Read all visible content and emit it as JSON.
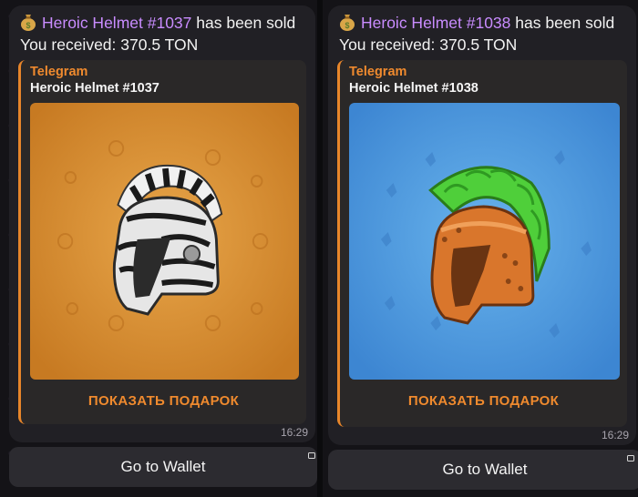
{
  "chats": [
    {
      "emoji_icon": "money-bag-icon",
      "gift_link": "Heroic Helmet #1037",
      "sold_text": " has been sold",
      "received_text": "You received: 370.5 TON",
      "preview": {
        "site_name": "Telegram",
        "title": "Heroic Helmet #1037",
        "image": "zebra-striped-helmet-on-orange",
        "background_color": "#d58a2c",
        "button_label": "ПОКАЗАТЬ ПОДАРОК"
      },
      "time": "16:29",
      "wallet_button": "Go to Wallet"
    },
    {
      "emoji_icon": "money-bag-icon",
      "gift_link": "Heroic Helmet #1038",
      "sold_text": " has been sold",
      "received_text": "You received: 370.5 TON",
      "preview": {
        "site_name": "Telegram",
        "title": "Heroic Helmet #1038",
        "image": "bronze-helmet-green-crest-on-blue",
        "background_color": "#4a92d8",
        "button_label": "ПОКАЗАТЬ ПОДАРОК"
      },
      "time": "16:29",
      "wallet_button": "Go to Wallet"
    }
  ],
  "colors": {
    "accent_orange": "#ef8a2e",
    "link_purple": "#c98cff",
    "bubble_bg": "#212025"
  }
}
